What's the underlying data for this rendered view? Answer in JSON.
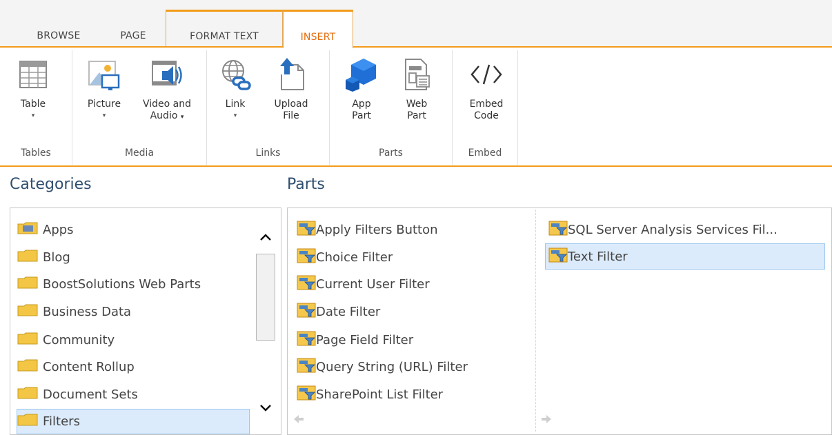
{
  "tabs": [
    {
      "label": "BROWSE"
    },
    {
      "label": "PAGE"
    },
    {
      "label": "FORMAT TEXT"
    },
    {
      "label": "INSERT"
    }
  ],
  "ribbon": {
    "groups": {
      "tables": "Tables",
      "media": "Media",
      "links": "Links",
      "parts": "Parts",
      "embed": "Embed"
    },
    "buttons": {
      "table": {
        "line1": "Table",
        "line2": ""
      },
      "picture": {
        "line1": "Picture",
        "line2": ""
      },
      "video": {
        "line1": "Video and",
        "line2": "Audio"
      },
      "link": {
        "line1": "Link",
        "line2": ""
      },
      "upload": {
        "line1": "Upload",
        "line2": "File"
      },
      "app_part": {
        "line1": "App",
        "line2": "Part"
      },
      "web_part": {
        "line1": "Web",
        "line2": "Part"
      },
      "embed": {
        "line1": "Embed",
        "line2": "Code"
      }
    },
    "dropdown_glyph": "▾"
  },
  "categories": {
    "heading": "Categories",
    "items": [
      "Apps",
      "Blog",
      "BoostSolutions Web Parts",
      "Business Data",
      "Community",
      "Content Rollup",
      "Document Sets",
      "Filters"
    ],
    "selected_index": 7
  },
  "parts": {
    "heading": "Parts",
    "col1": [
      "Apply Filters Button",
      "Choice Filter",
      "Current User Filter",
      "Date Filter",
      "Page Field Filter",
      "Query String (URL) Filter",
      "SharePoint List Filter"
    ],
    "col2": [
      "SQL Server Analysis Services Fil...",
      "Text Filter"
    ],
    "selected": "Text Filter"
  },
  "colors": {
    "accent_orange": "#f29b1a",
    "selected_tab_text": "#e46c0a",
    "selection_bg": "#dcebfb",
    "heading_blue": "#2f4f6f"
  }
}
